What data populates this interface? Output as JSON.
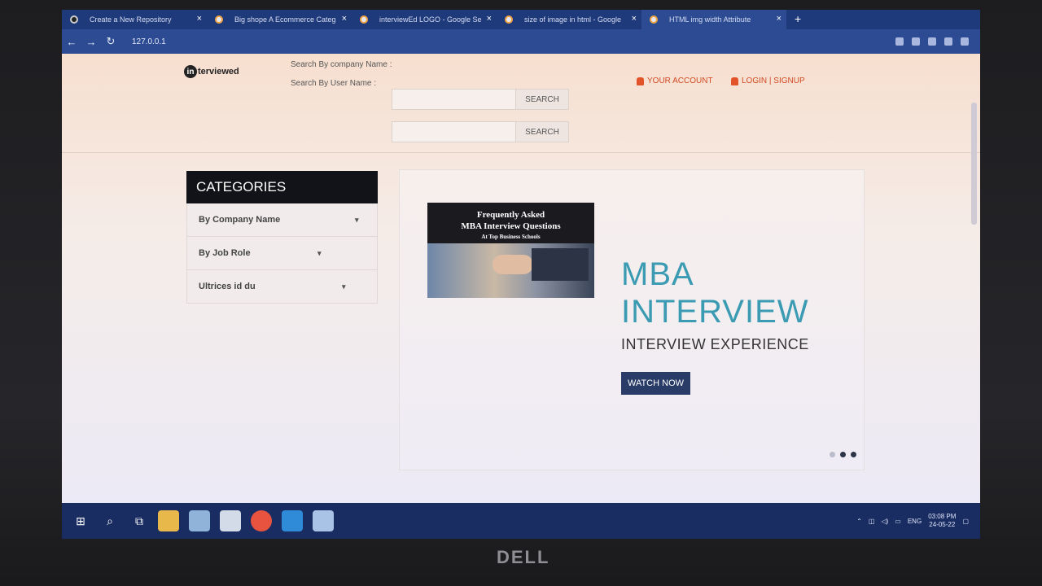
{
  "browser": {
    "tabs": [
      {
        "label": "Create a New Repository",
        "icon": "github-icon"
      },
      {
        "label": "Big shope A Ecommerce Categ",
        "icon": "page-icon"
      },
      {
        "label": "interviewEd LOGO - Google Se",
        "icon": "google-icon"
      },
      {
        "label": "size of image in html - Google",
        "icon": "google-icon"
      },
      {
        "label": "HTML img width Attribute",
        "icon": "page-icon"
      }
    ],
    "new_tab": "+",
    "address": "127.0.0.1"
  },
  "header": {
    "logo_mark": "in",
    "logo_text": "terviewed",
    "company_label": "Search By company Name :",
    "user_label": "Search By User Name :",
    "search_button_1": "SEARCH",
    "search_button_2": "SEARCH",
    "your_account": "YOUR ACCOUNT",
    "login_signup": "LOGIN | SIGNUP"
  },
  "categories": {
    "title": "CATEGORIES",
    "items": [
      {
        "label": "By Company Name"
      },
      {
        "label": "By Job Role"
      },
      {
        "label": "Ultrices id du"
      }
    ]
  },
  "banner": {
    "thumb_line1": "Frequently Asked",
    "thumb_line2": "MBA Interview Questions",
    "thumb_line3": "At Top Business Schools",
    "title_line1": "MBA",
    "title_line2": "INTERVIEW",
    "subtitle": "INTERVIEW EXPERIENCE",
    "cta": "WATCH NOW",
    "slides_count": 3,
    "active_slide": 2
  },
  "taskbar": {
    "language": "ENG",
    "time": "03:08 PM",
    "date": "24-05-22"
  },
  "device_brand": "DELL"
}
